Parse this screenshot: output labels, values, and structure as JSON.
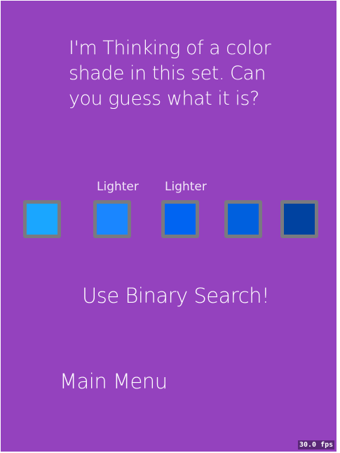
{
  "prompt": "I'm Thinking of a color shade in this set. Can you guess what it is?",
  "swatches": [
    {
      "color": "#1aa6ff",
      "label": ""
    },
    {
      "color": "#1a86ff",
      "label": "Lighter"
    },
    {
      "color": "#0064f2",
      "label": "Lighter"
    },
    {
      "color": "#0060de",
      "label": ""
    },
    {
      "color": "#0042a0",
      "label": ""
    }
  ],
  "hint": "Use Binary Search!",
  "main_menu": "Main Menu",
  "fps": "30.0 fps",
  "colors": {
    "background": "#9442be",
    "swatch_border": "#7a7a80"
  }
}
